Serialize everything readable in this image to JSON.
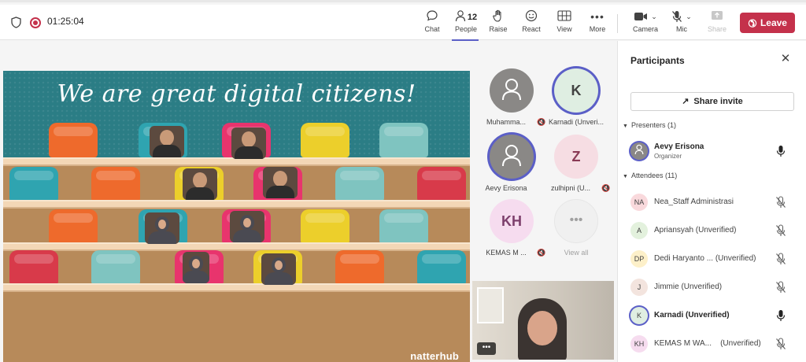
{
  "meeting": {
    "timer": "01:25:04"
  },
  "toolbar": {
    "chat": "Chat",
    "people": "People",
    "people_count": "12",
    "raise": "Raise",
    "react": "React",
    "view": "View",
    "more": "More",
    "camera": "Camera",
    "mic": "Mic",
    "share": "Share",
    "leave": "Leave"
  },
  "slide": {
    "title": "We are great digital citizens!",
    "brand": "natterhub"
  },
  "gallery": {
    "tiles": [
      {
        "name": "Muhamma...",
        "initials": "",
        "muted": true
      },
      {
        "name": "Karnadi (Unveri...",
        "initials": "K",
        "muted": false
      },
      {
        "name": "Aevy Erisona",
        "initials": "",
        "muted": false
      },
      {
        "name": "zulhipni (U...",
        "initials": "Z",
        "muted": true
      },
      {
        "name": "KEMAS M ...",
        "initials": "KH",
        "muted": true
      }
    ],
    "view_all": "View all",
    "more_symbol": "•••"
  },
  "self_video": {
    "menu": "•••"
  },
  "panel": {
    "title": "Participants",
    "share_invite": "Share invite",
    "presenters_label": "Presenters (1)",
    "attendees_label": "Attendees (11)",
    "presenters": [
      {
        "name": "Aevy Erisona",
        "role": "Organizer",
        "avatar": "",
        "mic": "on"
      }
    ],
    "attendees": [
      {
        "name": "Nea_Staff Administrasi",
        "initials": "NA",
        "avatar_color": "#f9d9dc",
        "mic": "muted"
      },
      {
        "name": "Apriansyah (Unverified)",
        "initials": "A",
        "avatar_color": "#e3f1dd",
        "mic": "muted"
      },
      {
        "name": "Dedi Haryanto ... (Unverified)",
        "initials": "DP",
        "avatar_color": "#fdf0c9",
        "mic": "muted"
      },
      {
        "name": "Jimmie (Unverified)",
        "initials": "J",
        "avatar_color": "#f3e4de",
        "mic": "muted"
      },
      {
        "name": "Karnadi (Unverified)",
        "initials": "K",
        "avatar_color": "#dfeee2",
        "mic": "on"
      },
      {
        "name": "KEMAS M WA...    (Unverified)",
        "initials": "KH",
        "avatar_color": "#f6dcef",
        "mic": "muted"
      }
    ]
  }
}
